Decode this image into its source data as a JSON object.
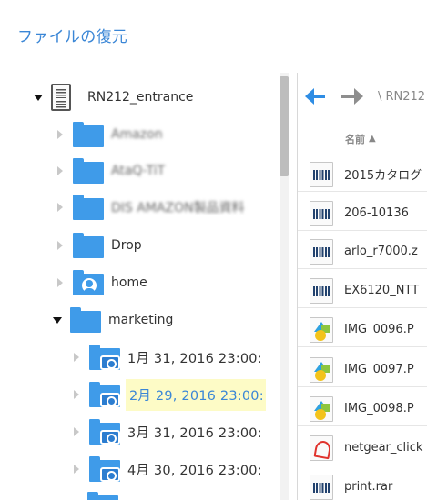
{
  "page_title": "ファイルの復元",
  "tree": {
    "nodes": [
      {
        "label": "RN212_entrance",
        "icon": "nas-device-icon",
        "expander": "expanded",
        "blurred": false
      },
      {
        "label": "Amazon",
        "icon": "folder-icon",
        "expander": "collapsed",
        "blurred": true
      },
      {
        "label": "AtaQ-TiT",
        "icon": "folder-icon",
        "expander": "collapsed",
        "blurred": true
      },
      {
        "label": "DIS AMAZON製品資料",
        "icon": "folder-icon",
        "expander": "collapsed",
        "blurred": true
      },
      {
        "label": "Drop",
        "icon": "folder-icon",
        "expander": "collapsed",
        "blurred": false
      },
      {
        "label": "home",
        "icon": "home-folder-icon",
        "expander": "collapsed",
        "blurred": false
      },
      {
        "label": "marketing",
        "icon": "folder-icon",
        "expander": "expanded",
        "blurred": false
      },
      {
        "label": "1月 31, 2016 23:00:",
        "icon": "snapshot-folder-icon",
        "expander": "collapsed",
        "blurred": false,
        "selected": false
      },
      {
        "label": "2月 29, 2016 23:00:",
        "icon": "snapshot-folder-icon",
        "expander": "collapsed",
        "blurred": false,
        "selected": true
      },
      {
        "label": "3月 31, 2016 23:00:",
        "icon": "snapshot-folder-icon",
        "expander": "collapsed",
        "blurred": false,
        "selected": false
      },
      {
        "label": "4月 30, 2016 23:00:",
        "icon": "snapshot-folder-icon",
        "expander": "collapsed",
        "blurred": false,
        "selected": false
      }
    ]
  },
  "file_panel": {
    "path": "\\ RN212",
    "column_name": "名前",
    "sort_indicator": "▲",
    "files": [
      {
        "name": "2015カタログ",
        "icon": "archive-icon"
      },
      {
        "name": "206-10136",
        "icon": "archive-icon"
      },
      {
        "name": "arlo_r7000.z",
        "icon": "archive-icon"
      },
      {
        "name": "EX6120_NTT",
        "icon": "archive-icon"
      },
      {
        "name": "IMG_0096.P",
        "icon": "image-icon"
      },
      {
        "name": "IMG_0097.P",
        "icon": "image-icon"
      },
      {
        "name": "IMG_0098.P",
        "icon": "image-icon"
      },
      {
        "name": "netgear_click",
        "icon": "pdf-icon"
      },
      {
        "name": "print.rar",
        "icon": "archive-icon"
      }
    ]
  },
  "colors": {
    "accent": "#3a86d6",
    "folder": "#3f9be9",
    "selected_background": "#fdfbc6"
  }
}
